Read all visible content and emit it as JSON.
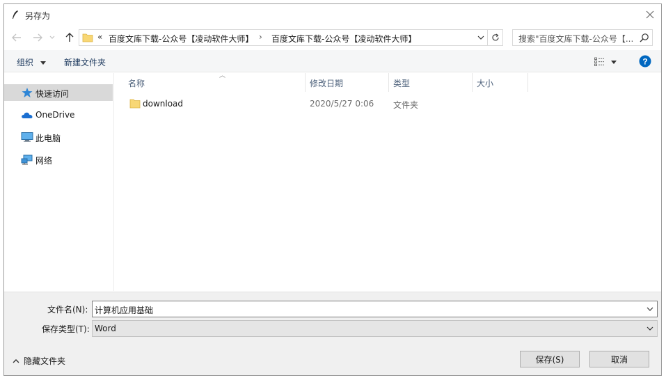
{
  "window": {
    "title": "另存为"
  },
  "address": {
    "overflow": "«",
    "segments": [
      "百度文库下载-公众号【凌动软件大师】",
      "百度文库下载-公众号【凌动软件大师】"
    ],
    "separator": "›"
  },
  "search": {
    "placeholder": "搜索\"百度文库下载-公众号【..."
  },
  "toolbar": {
    "organize_label": "组织",
    "new_folder_label": "新建文件夹"
  },
  "sidebar": {
    "items": [
      {
        "label": "快速访问",
        "icon": "star-icon",
        "selected": true
      },
      {
        "label": "OneDrive",
        "icon": "cloud-icon",
        "selected": false
      },
      {
        "label": "此电脑",
        "icon": "computer-icon",
        "selected": false
      },
      {
        "label": "网络",
        "icon": "network-icon",
        "selected": false
      }
    ]
  },
  "filelist": {
    "columns": [
      "名称",
      "修改日期",
      "类型",
      "大小"
    ],
    "rows": [
      {
        "name": "download",
        "date": "2020/5/27 0:06",
        "type": "文件夹",
        "size": ""
      }
    ]
  },
  "form": {
    "filename_label": "文件名(N):",
    "filename_value": "计算机应用基础",
    "filetype_label": "保存类型(T):",
    "filetype_value": "Word"
  },
  "footer": {
    "hide_folders_label": "隐藏文件夹",
    "save_label": "保存(S)",
    "cancel_label": "取消"
  },
  "colors": {
    "accent": "#0067c0",
    "folder": "#f8d775",
    "selected_bg": "#d9d9d9"
  }
}
